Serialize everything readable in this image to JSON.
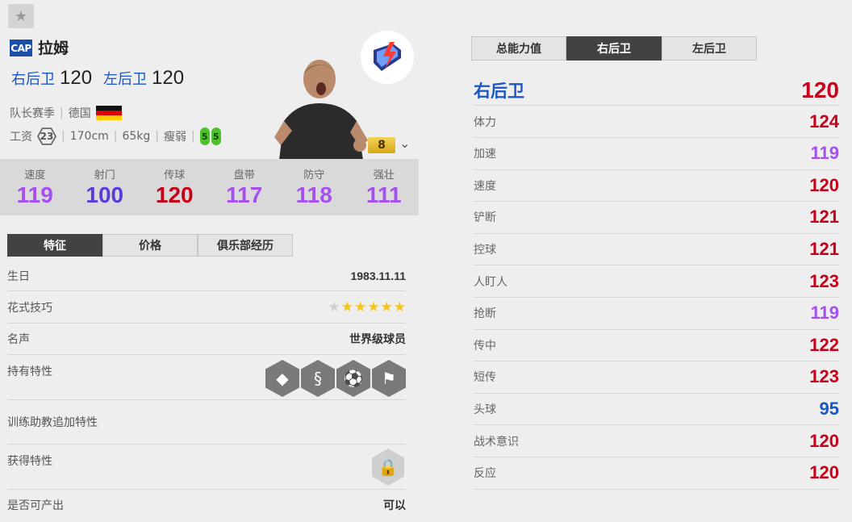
{
  "favorite": {
    "icon": "star-icon"
  },
  "player": {
    "season_badge": "CAP",
    "name": "拉姆",
    "positions": [
      {
        "name": "右后卫",
        "rating": "120"
      },
      {
        "name": "左后卫",
        "rating": "120"
      }
    ],
    "season_name": "队长赛季",
    "nation": "德国",
    "salary_label": "工资",
    "salary": "23",
    "height": "170cm",
    "weight": "65kg",
    "body_type": "瘦弱",
    "weak_foot_left": "5",
    "weak_foot_right": "5",
    "upgrade_level": "8"
  },
  "colors": {
    "cyan_stat": "#a855f7",
    "red_stat": "#c6001a",
    "blue_stat": "#1a56c4"
  },
  "summary_stats": [
    {
      "label": "速度",
      "value": "119",
      "color": "#a64ff0"
    },
    {
      "label": "射门",
      "value": "100",
      "color": "#5b3bd8"
    },
    {
      "label": "传球",
      "value": "120",
      "color": "#c6001a"
    },
    {
      "label": "盘带",
      "value": "117",
      "color": "#a64ff0"
    },
    {
      "label": "防守",
      "value": "118",
      "color": "#a64ff0"
    },
    {
      "label": "强壮",
      "value": "111",
      "color": "#a64ff0"
    }
  ],
  "left_tabs": [
    "特征",
    "价格",
    "俱乐部经历"
  ],
  "details": {
    "birthday_label": "生日",
    "birthday": "1983.11.11",
    "skill_label": "花式技巧",
    "skill_stars": 5,
    "fame_label": "名声",
    "fame": "世界级球员",
    "traits_label": "持有特性",
    "coach_traits_label": "训练助教追加特性",
    "acquired_traits_label": "获得特性",
    "producible_label": "是否可产出",
    "producible": "可以"
  },
  "right_tabs": [
    "总能力值",
    "右后卫",
    "左后卫"
  ],
  "position_detail": {
    "title": "右后卫",
    "value": "120"
  },
  "attributes": [
    {
      "name": "体力",
      "value": "124",
      "color": "#c6001a"
    },
    {
      "name": "加速",
      "value": "119",
      "color": "#a64ff0"
    },
    {
      "name": "速度",
      "value": "120",
      "color": "#c6001a"
    },
    {
      "name": "铲断",
      "value": "121",
      "color": "#c6001a"
    },
    {
      "name": "控球",
      "value": "121",
      "color": "#c6001a"
    },
    {
      "name": "人盯人",
      "value": "123",
      "color": "#c6001a"
    },
    {
      "name": "抢断",
      "value": "119",
      "color": "#a64ff0"
    },
    {
      "name": "传中",
      "value": "122",
      "color": "#c6001a"
    },
    {
      "name": "短传",
      "value": "123",
      "color": "#c6001a"
    },
    {
      "name": "头球",
      "value": "95",
      "color": "#1a56c4"
    },
    {
      "name": "战术意识",
      "value": "120",
      "color": "#c6001a"
    },
    {
      "name": "反应",
      "value": "120",
      "color": "#c6001a"
    }
  ]
}
